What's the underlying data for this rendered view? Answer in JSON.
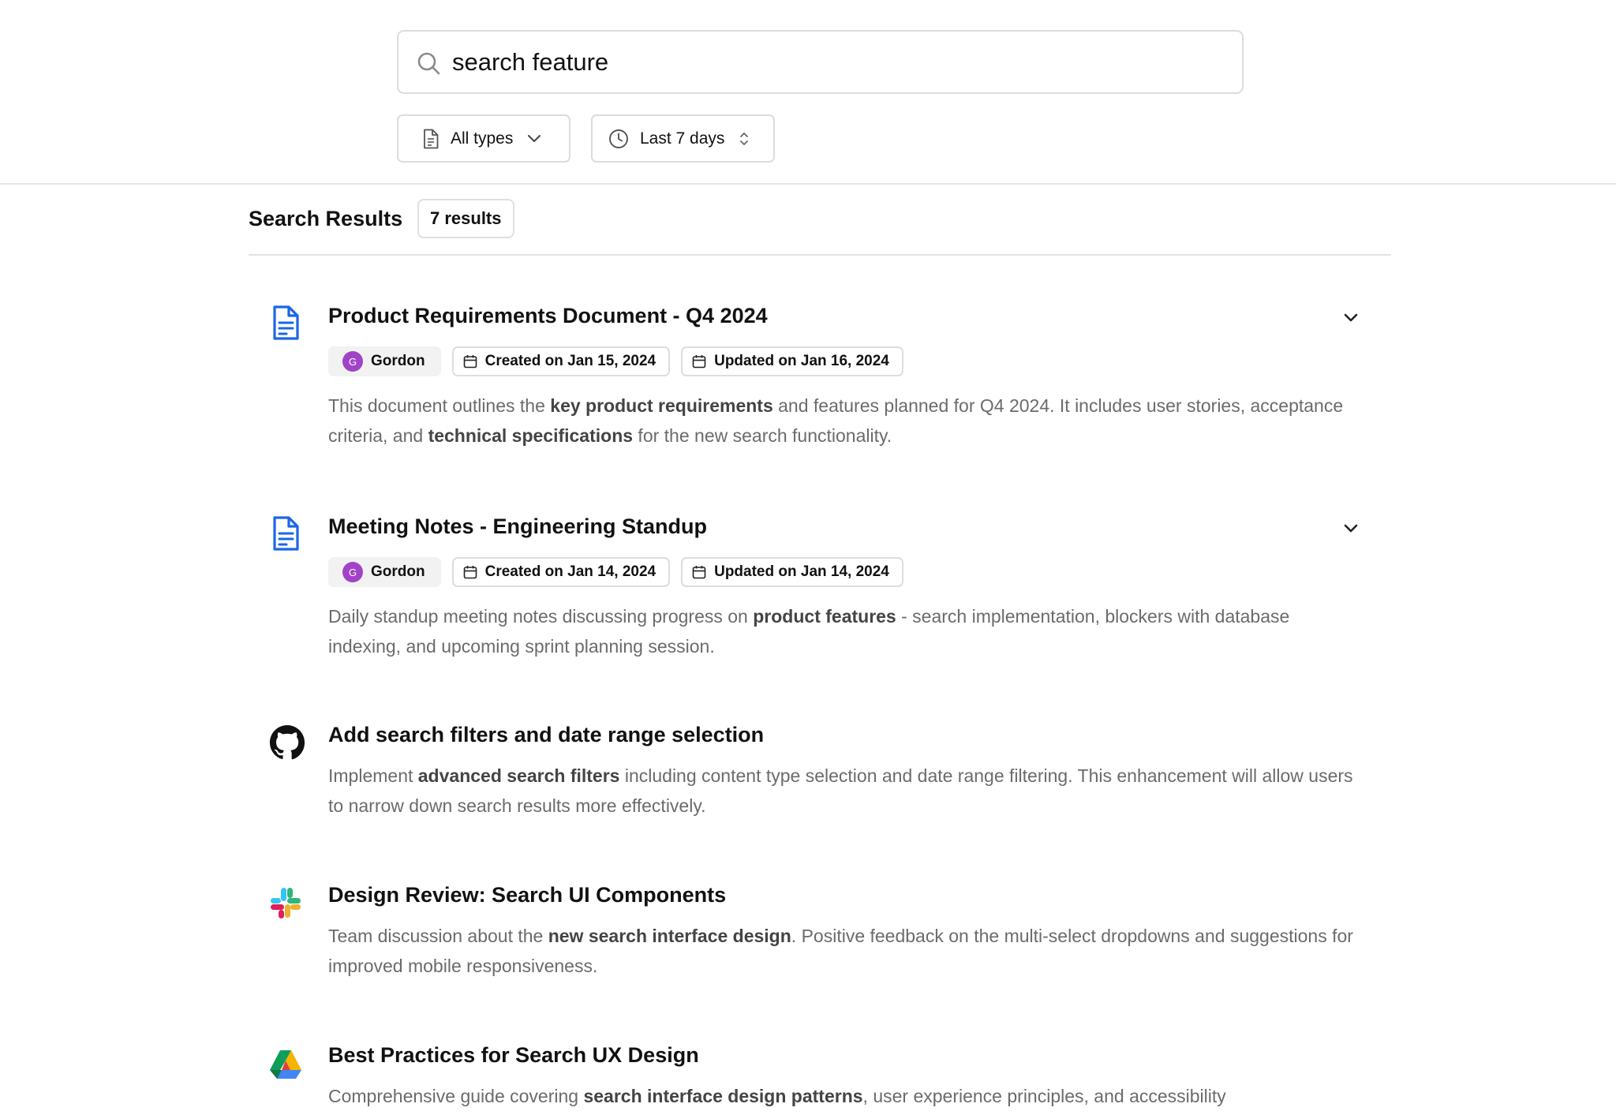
{
  "search": {
    "query": "search feature"
  },
  "filters": {
    "type_label": "All types",
    "date_label": "Last 7 days"
  },
  "results_header": {
    "title": "Search Results",
    "count": "7 results"
  },
  "results": [
    {
      "source_icon": "document-icon",
      "title": "Product Requirements Document - Q4 2024",
      "author": "Gordon",
      "avatar_initial": "G",
      "created": "Created on Jan 15, 2024",
      "updated": "Updated on Jan 16, 2024",
      "desc_parts": [
        "This document outlines the ",
        "key product requirements",
        " and features planned for Q4 2024. It includes user stories, acceptance criteria, and ",
        "technical specifications",
        " for the new search functionality."
      ]
    },
    {
      "source_icon": "document-icon",
      "title": "Meeting Notes - Engineering Standup",
      "author": "Gordon",
      "avatar_initial": "G",
      "created": "Created on Jan 14, 2024",
      "updated": "Updated on Jan 14, 2024",
      "desc_parts": [
        "Daily standup meeting notes discussing progress on ",
        "product features",
        " - search implementation, blockers with database indexing, and upcoming sprint planning session."
      ]
    },
    {
      "source_icon": "github-icon",
      "title": "Add search filters and date range selection",
      "desc_parts": [
        "Implement ",
        "advanced search filters",
        " including content type selection and date range filtering. This enhancement will allow users to narrow down search results more effectively."
      ]
    },
    {
      "source_icon": "slack-icon",
      "title": "Design Review: Search UI Components",
      "desc_parts": [
        "Team discussion about the ",
        "new search interface design",
        ". Positive feedback on the multi-select dropdowns and suggestions for improved mobile responsiveness."
      ]
    },
    {
      "source_icon": "google-drive-icon",
      "title": "Best Practices for Search UX Design",
      "desc_parts": [
        "Comprehensive guide covering ",
        "search interface design patterns",
        ", user experience principles, and accessibility"
      ]
    }
  ],
  "colors": {
    "doc_icon_blue": "#1a66e8",
    "avatar_purple": "#a143c7"
  }
}
